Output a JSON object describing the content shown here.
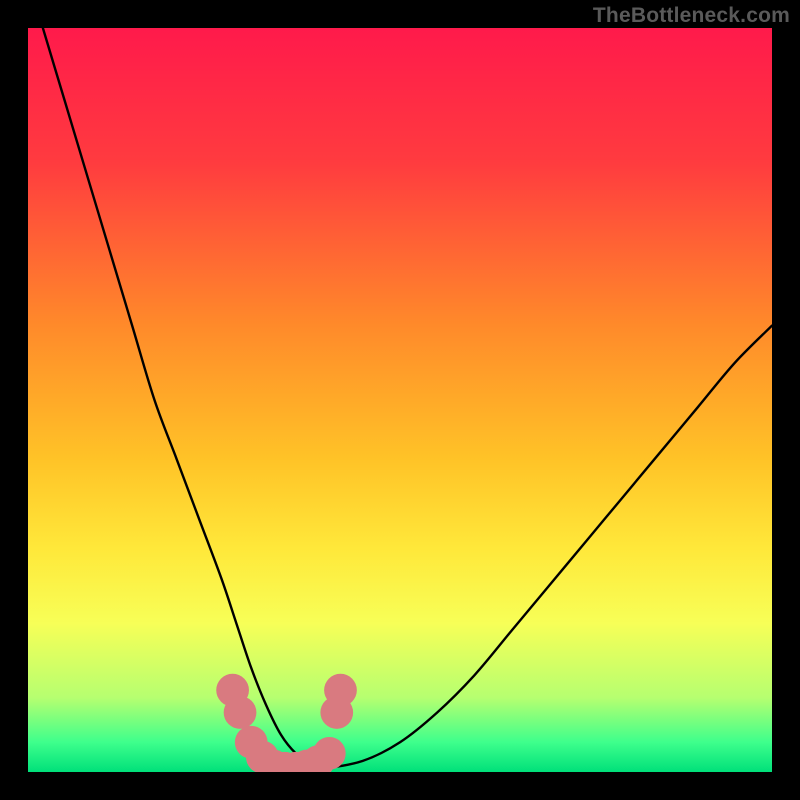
{
  "attribution": "TheBottleneck.com",
  "chart_data": {
    "type": "line",
    "title": "",
    "xlabel": "",
    "ylabel": "",
    "xlim": [
      0,
      100
    ],
    "ylim": [
      0,
      100
    ],
    "background_gradient": {
      "stops": [
        {
          "offset": 0,
          "color": "#ff1a4b"
        },
        {
          "offset": 18,
          "color": "#ff3b3f"
        },
        {
          "offset": 40,
          "color": "#ff8a2a"
        },
        {
          "offset": 58,
          "color": "#ffc327"
        },
        {
          "offset": 70,
          "color": "#ffe83a"
        },
        {
          "offset": 80,
          "color": "#f7ff57"
        },
        {
          "offset": 90,
          "color": "#b6ff70"
        },
        {
          "offset": 96,
          "color": "#3eff8c"
        },
        {
          "offset": 100,
          "color": "#00e07a"
        }
      ]
    },
    "series": [
      {
        "name": "bottleneck-curve",
        "x": [
          2,
          5,
          8,
          11,
          14,
          17,
          20,
          23,
          26,
          28,
          30,
          32,
          34,
          36,
          38,
          40,
          45,
          50,
          55,
          60,
          65,
          70,
          75,
          80,
          85,
          90,
          95,
          100
        ],
        "y": [
          100,
          90,
          80,
          70,
          60,
          50,
          42,
          34,
          26,
          20,
          14,
          9,
          5,
          2.5,
          1.2,
          0.6,
          1.5,
          4,
          8,
          13,
          19,
          25,
          31,
          37,
          43,
          49,
          55,
          60
        ]
      }
    ],
    "markers": {
      "name": "highlight-points",
      "color": "#d97a80",
      "radius": 2.2,
      "points": [
        {
          "x": 27.5,
          "y": 11
        },
        {
          "x": 28.5,
          "y": 8
        },
        {
          "x": 30,
          "y": 4
        },
        {
          "x": 31.5,
          "y": 2
        },
        {
          "x": 33,
          "y": 0.8
        },
        {
          "x": 34.5,
          "y": 0.5
        },
        {
          "x": 36,
          "y": 0.5
        },
        {
          "x": 37.5,
          "y": 0.8
        },
        {
          "x": 39,
          "y": 1.4
        },
        {
          "x": 40.5,
          "y": 2.5
        },
        {
          "x": 41.5,
          "y": 8
        },
        {
          "x": 42,
          "y": 11
        }
      ]
    }
  }
}
